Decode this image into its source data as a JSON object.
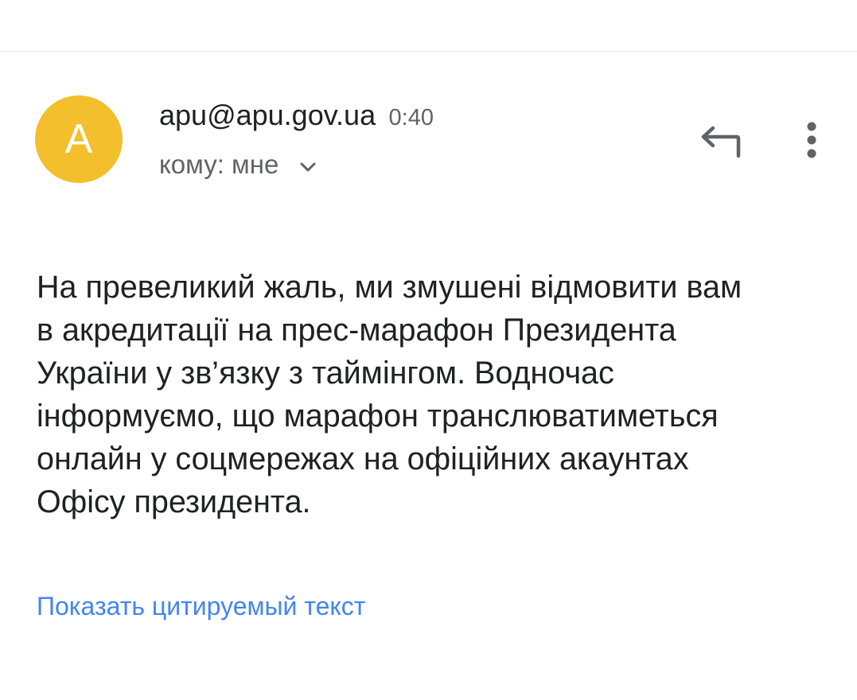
{
  "message": {
    "avatar_letter": "A",
    "sender": "apu@apu.gov.ua",
    "time": "0:40",
    "recipient": "кому: мне",
    "body_lines": [
      "На превеликий жаль, ми змушені відмовити вам",
      "в акредитації на прес-марафон Президента",
      "України у зв’язку з таймінгом. Водночас",
      "інформуємо, що марафон транслюватиметься",
      "онлайн у соцмережах на офіційних акаунтах",
      "Офісу президента."
    ],
    "show_quoted_label": "Показать цитируемый текст"
  },
  "icons": {
    "reply": "reply-icon",
    "more": "more-vert-icon",
    "expand": "chevron-down-icon"
  },
  "colors": {
    "avatar_bg": "#f4bf2c",
    "link": "#4285f4",
    "secondary_text": "#5f6368",
    "primary_text": "#202124"
  }
}
